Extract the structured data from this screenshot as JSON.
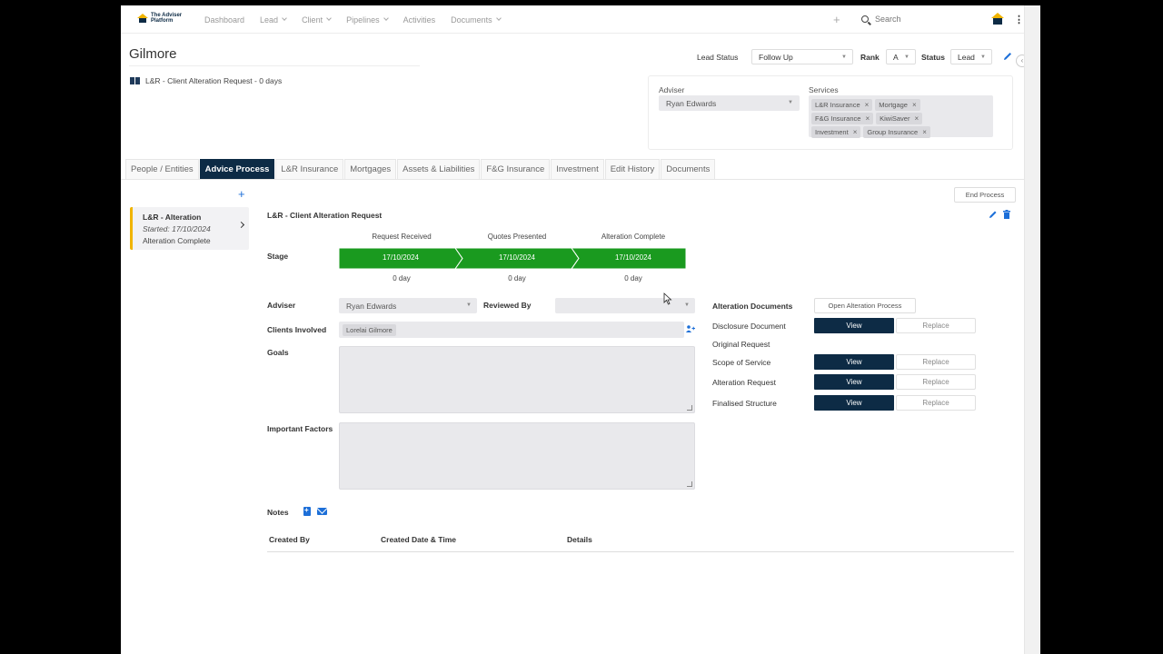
{
  "nav": {
    "logo_line1": "The Adviser",
    "logo_line2": "Platform",
    "items": [
      {
        "label": "Dashboard",
        "dropdown": false
      },
      {
        "label": "Lead",
        "dropdown": true
      },
      {
        "label": "Client",
        "dropdown": true
      },
      {
        "label": "Pipelines",
        "dropdown": true
      },
      {
        "label": "Activities",
        "dropdown": false
      },
      {
        "label": "Documents",
        "dropdown": true
      }
    ],
    "search_placeholder": "Search",
    "add_symbol": "+",
    "more_symbol": "⋮"
  },
  "header": {
    "title": "Gilmore",
    "subtitle": "L&R - Client Alteration Request - 0 days",
    "lead_status_label": "Lead Status",
    "lead_status_value": "Follow Up",
    "rank_label": "Rank",
    "rank_value": "A",
    "status_label": "Status",
    "status_value": "Lead"
  },
  "panel": {
    "adviser_label": "Adviser",
    "adviser_value": "Ryan Edwards",
    "services_label": "Services",
    "services": [
      "L&R Insurance",
      "Mortgage",
      "F&G Insurance",
      "KiwiSaver",
      "Investment",
      "Group Insurance"
    ]
  },
  "tabs": [
    {
      "label": "People / Entities",
      "active": false
    },
    {
      "label": "Advice Process",
      "active": true
    },
    {
      "label": "L&R Insurance",
      "active": false
    },
    {
      "label": "Mortgages",
      "active": false
    },
    {
      "label": "Assets & Liabilities",
      "active": false
    },
    {
      "label": "F&G Insurance",
      "active": false
    },
    {
      "label": "Investment",
      "active": false
    },
    {
      "label": "Edit History",
      "active": false
    },
    {
      "label": "Documents",
      "active": false
    }
  ],
  "process_list": {
    "add_symbol": "+",
    "card": {
      "title": "L&R - Alteration",
      "started": "Started: 17/10/2024",
      "current": "Alteration Complete"
    }
  },
  "process": {
    "end_label": "End Process",
    "title": "L&R - Client Alteration Request",
    "stage_label": "Stage",
    "stages": [
      {
        "name": "Request Received",
        "date": "17/10/2024",
        "days": "0 day"
      },
      {
        "name": "Quotes Presented",
        "date": "17/10/2024",
        "days": "0 day"
      },
      {
        "name": "Alteration Complete",
        "date": "17/10/2024",
        "days": "0 day"
      }
    ],
    "stage_color": "#1a9a1f",
    "adviser_label": "Adviser",
    "adviser_value": "Ryan Edwards",
    "reviewed_by_label": "Reviewed By",
    "reviewed_by_value": "",
    "clients_label": "Clients Involved",
    "clients": [
      "Lorelai Gilmore"
    ],
    "goals_label": "Goals",
    "important_factors_label": "Important Factors"
  },
  "documents": {
    "heading": "Alteration Documents",
    "open_button": "Open Alteration Process",
    "view_label": "View",
    "replace_label": "Replace",
    "items": [
      {
        "name": "Disclosure Document",
        "has_file": true
      },
      {
        "name": "Original Request",
        "has_file": false
      },
      {
        "name": "Scope of Service",
        "has_file": true
      },
      {
        "name": "Alteration Request",
        "has_file": true
      },
      {
        "name": "Finalised Structure",
        "has_file": true
      }
    ]
  },
  "notes": {
    "label": "Notes",
    "columns": [
      "Created By",
      "Created Date & Time",
      "Details"
    ]
  },
  "colors": {
    "primary": "#0d2b45",
    "accent": "#f0b400",
    "link": "#1d6fd8",
    "stage_green": "#1a9a1f"
  }
}
